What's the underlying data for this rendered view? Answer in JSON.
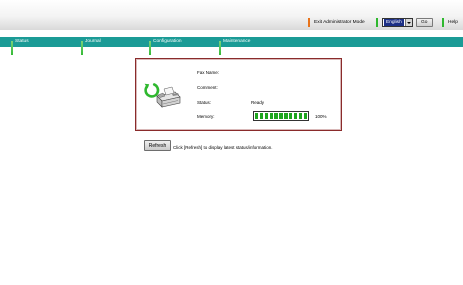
{
  "header": {
    "exit_admin_label": "Exit Administrator Mode",
    "language": {
      "selected": "English"
    },
    "go_label": "Go",
    "help_label": "Help"
  },
  "nav": {
    "tabs": [
      {
        "label": "Status"
      },
      {
        "label": "Journal"
      },
      {
        "label": "Configuration"
      },
      {
        "label": "Maintenance"
      }
    ]
  },
  "status_panel": {
    "fax_name_label": "Fax Name:",
    "fax_name_value": "",
    "comment_label": "Comment:",
    "comment_value": "",
    "status_label": "Status:",
    "status_value": "Ready",
    "memory_label": "Memory:",
    "memory_percent_text": "100%",
    "memory_fraction": 1.0,
    "memory_segments": 11
  },
  "refresh": {
    "button_label": "Refresh",
    "hint": "Click [Refresh] to display latest status/information."
  },
  "colors": {
    "nav_band": "#1b9b96",
    "accent_green": "#2fb82f",
    "accent_orange": "#e8731a",
    "memory_fill": "#1ea51e",
    "selected_language_bg": "#1c2f86",
    "panel_border": "#8a2b2b"
  },
  "icons": {
    "status_icon": "fax-machine-icon",
    "refresh_indicator": "circular-refresh-icon"
  }
}
